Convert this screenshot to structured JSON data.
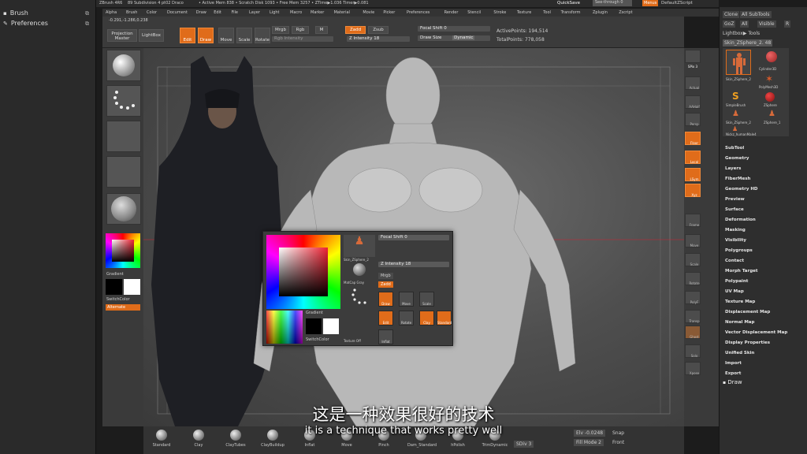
{
  "top_bar": {
    "app_title": "ZBrush 4R6",
    "subdivision": "89 Subdivision 4 pt02 Draco",
    "status": "• Active Mem 838 • Scratch Disk 1093 • Free Mem 3257 • ZTime▶1.036 Timer▶0.081",
    "quicksave": "QuickSave",
    "see_through": "See-through 0",
    "menus_btn": "Menus",
    "default_script": "DefaultZScript"
  },
  "menu_bar": [
    "Alpha",
    "Brush",
    "Color",
    "Document",
    "Draw",
    "Edit",
    "File",
    "Layer",
    "Light",
    "Macro",
    "Marker",
    "Material",
    "Movie",
    "Picker",
    "Preferences",
    "Render",
    "Stencil",
    "Stroke",
    "Texture",
    "Tool",
    "Transform",
    "Zplugin",
    "Zscript"
  ],
  "left_panel": {
    "items": [
      {
        "label": "Brush"
      },
      {
        "label": "Preferences"
      }
    ]
  },
  "toolbar": {
    "coords": "-0.291,-1.286,0.238",
    "projection_master": "Projection Master",
    "lightbox": "LightBox",
    "edit": "Edit",
    "draw": "Draw",
    "move": "Move",
    "scale": "Scale",
    "rotate": "Rotate",
    "mrgb": "Mrgb",
    "rgb": "Rgb",
    "m": "M",
    "zadd": "Zadd",
    "zsub": "Zsub",
    "rgb_intensity": "Rgb Intensity",
    "z_intensity": "Z Intensity 18",
    "focal_shift": "Focal Shift 0",
    "draw_size": "Draw Size",
    "dynamic": "Dynamic",
    "active_points": "ActivePoints: 194,514",
    "total_points": "TotalPoints: 778,058"
  },
  "shelf": {
    "labels": [
      "",
      "Dots",
      "Alpha Off",
      "Texture Off",
      "MatCap Gray"
    ],
    "gradient": "Gradient",
    "switch_color": "SwitchColor",
    "alternate": "Alternate"
  },
  "right_shelf": {
    "buttons": [
      "BPR",
      "SPix 3",
      "Actual",
      "AAHalf",
      "Persp",
      "Floor",
      "Local",
      "LSym",
      "Xyz",
      "Frame",
      "Move",
      "Scale",
      "Rotate",
      "PolyF",
      "Transp",
      "Ghost",
      "Solo",
      "Xpose"
    ]
  },
  "right_panel": {
    "top_buttons": [
      "Clone",
      "All SubTools",
      "GoZ",
      "All",
      "Visible",
      "R"
    ],
    "lightbox_tools": "Lightbox▶ Tools",
    "current_tool": "Skin_ZSphere_2. 48",
    "tools": [
      "Skin_ZSphere_2",
      "Cylinder3D",
      "PolyMesh3D",
      "SimpleBrush",
      "ZSphere",
      "Skin_ZSphere_2",
      "ZSphere_1",
      "Nickz_humanMale4"
    ],
    "menu_items": [
      "SubTool",
      "Geometry",
      "Layers",
      "FiberMesh",
      "Geometry HD",
      "Preview",
      "Surface",
      "Deformation",
      "Masking",
      "Visibility",
      "Polygroups",
      "Contact",
      "Morph Target",
      "Polypaint",
      "UV Map",
      "Texture Map",
      "Displacement Map",
      "Normal Map",
      "Vector Displacement Map",
      "Display Properties",
      "Unified Skin",
      "Import",
      "Export"
    ],
    "draw": "Draw"
  },
  "bottom_shelf": {
    "brushes": [
      "Standard",
      "Clay",
      "ClayTubes",
      "ClayBuildup",
      "Inflat",
      "Move",
      "Pinch",
      "Dam_Standard",
      "hPolish",
      "TrimDynamic"
    ],
    "sdiv": "SDiv 3",
    "elv": "Elv -0.0248",
    "fill_mode": "Fill Mode 2",
    "snap": "Snap",
    "front": "Front"
  },
  "popup": {
    "gradient": "Gradient",
    "switch_color": "SwitchColor",
    "focal_shift": "Focal Shift 0",
    "z_intensity": "Z Intensity 18",
    "mrgb": "Mrgb",
    "zadd": "Zadd",
    "edit": "Edit",
    "draw": "Draw",
    "move": "Move",
    "scale": "Scale",
    "rotate": "Rotate",
    "inflat": "Inflat",
    "standard": "Standard",
    "clay": "Clay",
    "brush_label": "Skin_ZSphere_2",
    "matcap": "MatCap Gray",
    "texture": "Texture Off"
  },
  "subtitles": {
    "chinese": "这是一种效果很好的技术",
    "english": "it is a technique that works pretty well"
  },
  "colors": {
    "accent": "#e06c1a",
    "panel": "#2e2e2e",
    "canvas": "#4f4f4f"
  }
}
